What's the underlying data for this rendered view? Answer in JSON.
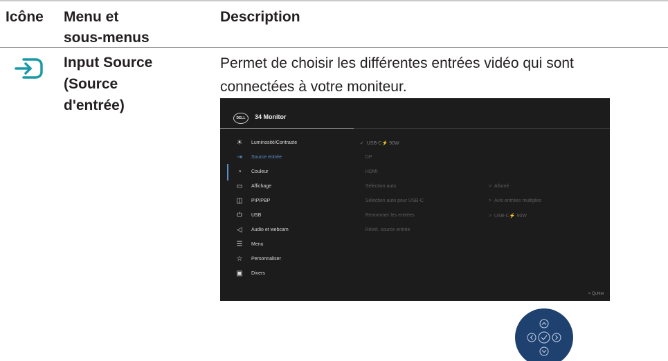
{
  "header": {
    "col_icon": "Icône",
    "col_menu_line1": "Menu et",
    "col_menu_line2": "sous-menus",
    "col_description": "Description"
  },
  "row": {
    "icon": "input-source-icon",
    "name_line1": "Input Source",
    "name_line2": "(Source",
    "name_line3": "d'entrée)",
    "desc_line1": "Permet de choisir les différentes entrées vidéo qui sont",
    "desc_line2": "connectées à votre moniteur."
  },
  "osd": {
    "logo": "DELL",
    "title": "34 Monitor",
    "menu": [
      {
        "label": "Luminosité/Contraste",
        "icon": "brightness-icon",
        "active": false
      },
      {
        "label": "Source entrée",
        "icon": "input-icon",
        "active": true
      },
      {
        "label": "Couleur",
        "icon": "palette-icon",
        "active": false
      },
      {
        "label": "Affichage",
        "icon": "display-icon",
        "active": false
      },
      {
        "label": "PIP/PBP",
        "icon": "pip-icon",
        "active": false
      },
      {
        "label": "USB",
        "icon": "usb-icon",
        "active": false
      },
      {
        "label": "Audio et webcam",
        "icon": "speaker-icon",
        "active": false
      },
      {
        "label": "Menu",
        "icon": "menu-icon",
        "active": false
      },
      {
        "label": "Personnaliser",
        "icon": "star-icon",
        "active": false
      },
      {
        "label": "Divers",
        "icon": "info-icon",
        "active": false
      }
    ],
    "options": [
      {
        "label": "USB-C",
        "suffix": "90W",
        "selected": true
      },
      {
        "label": "DP"
      },
      {
        "label": "HDMI"
      },
      {
        "label": "Sélection auto",
        "value": "Allumé"
      },
      {
        "label": "Sélection auto pour USB-C",
        "value": "Avis entrées multiples"
      },
      {
        "label": "Renommer les entrées",
        "value": "USB-C",
        "value_suffix": "90W"
      },
      {
        "label": "Réinit. source entrée"
      }
    ],
    "quit_label": "Quitter"
  },
  "joystick": {
    "icon": "joystick-icon"
  },
  "colors": {
    "accent": "#5a8fc8",
    "osd_bg": "#1c1c1c",
    "text": "#231f20",
    "icon_teal": "#1a9aa8"
  }
}
